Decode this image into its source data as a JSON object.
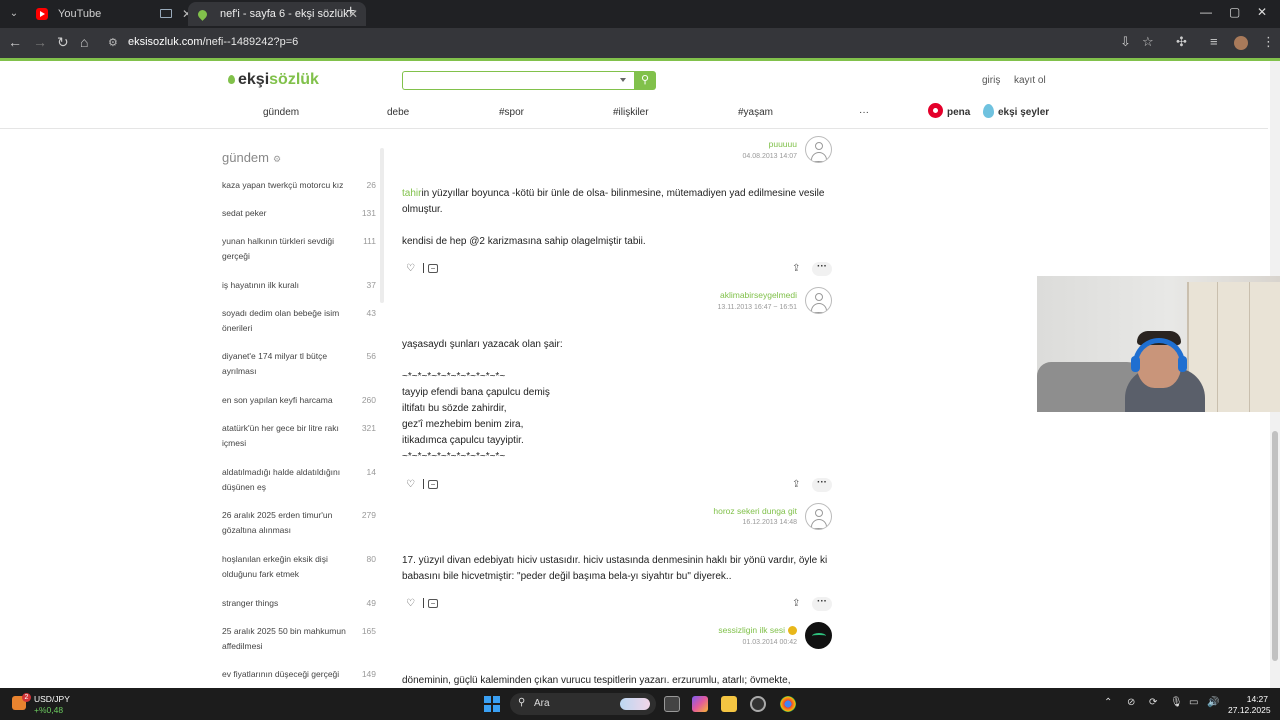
{
  "browser": {
    "tabs": [
      {
        "title": "YouTube",
        "favicon": "youtube-icon"
      },
      {
        "title": "nef'i - sayfa 6 - ekşi sözlük",
        "favicon": "eksi-drop-icon"
      }
    ],
    "url_host": "eksisozluk.com",
    "url_path": "/nefi--1489242?p=6",
    "new_tab": "+",
    "win_min": "—",
    "win_max": "▢",
    "win_close": "✕"
  },
  "site": {
    "logo_eksi": "ekşi",
    "logo_sozluk": "sözlük",
    "search_placeholder": "",
    "login": "giriş",
    "register": "kayıt ol",
    "nav": [
      "gündem",
      "debe",
      "#spor",
      "#ilişkiler",
      "#yaşam",
      "···"
    ],
    "pena": "pena",
    "seyler": "ekşi şeyler",
    "accent_color": "#81c14b"
  },
  "sidebar": {
    "title": "gündem",
    "topics": [
      {
        "title": "kaza yapan twerkçü motorcu kız",
        "count": "26"
      },
      {
        "title": "sedat peker",
        "count": "131"
      },
      {
        "title": "yunan halkının türkleri sevdiği gerçeği",
        "count": "111"
      },
      {
        "title": "iş hayatının ilk kuralı",
        "count": "37"
      },
      {
        "title": "soyadı dedim olan bebeğe isim önerileri",
        "count": "43"
      },
      {
        "title": "diyanet'e 174 milyar tl bütçe ayrılması",
        "count": "56"
      },
      {
        "title": "en son yapılan keyfi harcama",
        "count": "260"
      },
      {
        "title": "atatürk'ün her gece bir litre rakı içmesi",
        "count": "321"
      },
      {
        "title": "aldatılmadığı halde aldatıldığını düşünen eş",
        "count": "14"
      },
      {
        "title": "26 aralık 2025 erden timur'un gözaltına alınması",
        "count": "279"
      },
      {
        "title": "hoşlanılan erkeğin eksik dişi olduğunu fark etmek",
        "count": "80"
      },
      {
        "title": "stranger things",
        "count": "49"
      },
      {
        "title": "25 aralık 2025 50 bin mahkumun affedilmesi",
        "count": "165"
      },
      {
        "title": "ev fiyatlarının düşeceği gerçeği",
        "count": "149"
      }
    ]
  },
  "entries": [
    {
      "author": "puuuuu",
      "date": "04.08.2013 14:07"
    },
    {
      "text_link": "tahir",
      "text": "in yüzyıllar boyunca -kötü bir ünle de olsa- bilinmesine, mütemadiyen yad edilmesine vesile olmuştur.\n\nkendisi de hep @2 karizmasına sahip olagelmiştir tabii.",
      "author": "aklimabirseygelmedi",
      "date": "13.11.2013 16:47 ~ 16:51"
    },
    {
      "text": "yaşasaydı şunları yazacak olan şair:\n\n~*~*~*~*~*~*~*~*~*~*~\ntayyip efendi bana çapulcu demiş\niltifatı bu sözde zahirdir,\ngez'î mezhebim benim zira,\nitikadımca çapulcu tayyiptir.\n~*~*~*~*~*~*~*~*~*~*~",
      "author": "horoz sekeri dunga git",
      "date": "16.12.2013 14:48"
    },
    {
      "text": "17. yüzyıl divan edebiyatı hiciv ustasıdır. hiciv ustasında denmesinin haklı bir yönü vardır, öyle ki babasını bile hicvetmiştir: \"peder değil başıma bela-yı siyahtır bu\" diyerek..",
      "author": "sessizligin ilk sesi",
      "date": "01.03.2014 00:42"
    },
    {
      "text": "döneminin, güçlü kaleminden çıkan vurucu tespitlerin yazarı. erzurumlu, atarlı; övmekte,"
    }
  ],
  "taskbar": {
    "ticker_name": "USD/JPY",
    "ticker_value": "+%0,48",
    "ticker_badge": "2",
    "search_label": "Ara",
    "time": "14:27",
    "date": "27.12.2025"
  }
}
